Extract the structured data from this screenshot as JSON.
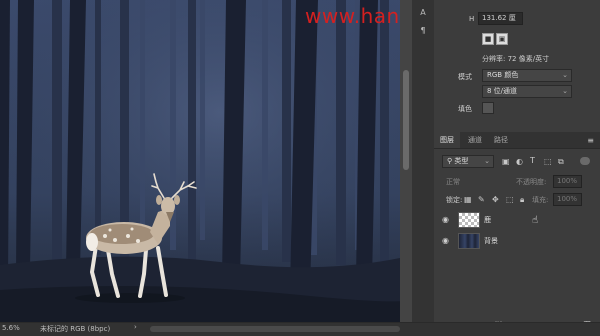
{
  "watermark": "www.hanxiaoyan.com",
  "strip": {
    "icon_a": "A",
    "icon_para": "¶"
  },
  "image_size": {
    "h_label": "H",
    "h_value": "131.62 厘",
    "resolution": "分辨率: 72 像素/英寸"
  },
  "mode": {
    "label": "模式",
    "color_mode": "RGB 颜色",
    "bit_depth": "8 位/通道",
    "fill_label": "填色"
  },
  "tabs": [
    {
      "label": "图层",
      "active": true
    },
    {
      "label": "通道",
      "active": false
    },
    {
      "label": "路径",
      "active": false
    }
  ],
  "layers_toolbar": {
    "filter_kind": "类型",
    "blend_mode": "正常",
    "opacity_label": "不透明度:",
    "opacity_value": "100%",
    "lock_label": "锁定:",
    "fill_label": "填充:",
    "fill_value": "100%"
  },
  "layers": [
    {
      "name": "鹿",
      "visible": true,
      "transparent": true
    },
    {
      "name": "背景",
      "visible": true,
      "transparent": false
    }
  ],
  "status": {
    "zoom": "5.6%",
    "doc_info": "未标记的 RGB (8bpc)"
  },
  "icons": {
    "eye": "eye-icon",
    "cursor": "hand-cursor-icon"
  },
  "colors": {
    "watermark": "#d42020",
    "panel_bg": "#3c3c3c",
    "scene": "#2d3a55"
  }
}
